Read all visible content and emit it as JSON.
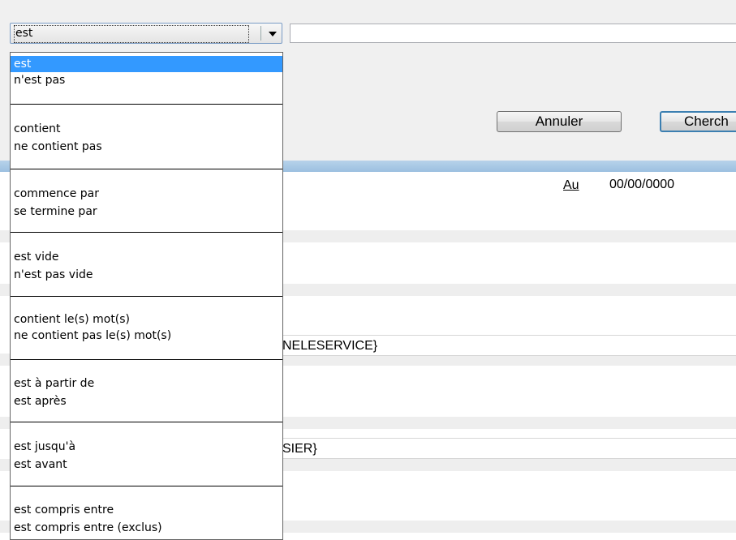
{
  "combo": {
    "selected": "est"
  },
  "search_value": "",
  "buttons": {
    "cancel": "Annuler",
    "search": "Cherch"
  },
  "date_filter": {
    "label": "Au",
    "value": "00/00/0000"
  },
  "fields": {
    "service_value": "NELESERVICE}",
    "dossier_value": "SIER}"
  },
  "dropdown": {
    "groups": [
      [
        "est",
        "n'est pas"
      ],
      [
        "contient",
        "ne contient pas"
      ],
      [
        "commence par",
        "se termine par"
      ],
      [
        "est vide",
        "n'est pas vide"
      ],
      [
        "contient le(s) mot(s)",
        "ne contient pas le(s) mot(s)"
      ],
      [
        "est à partir de",
        "est après"
      ],
      [
        "est jusqu'à",
        "est avant"
      ],
      [
        "est compris entre",
        "est compris entre (exclus)"
      ]
    ],
    "selected": "est"
  }
}
